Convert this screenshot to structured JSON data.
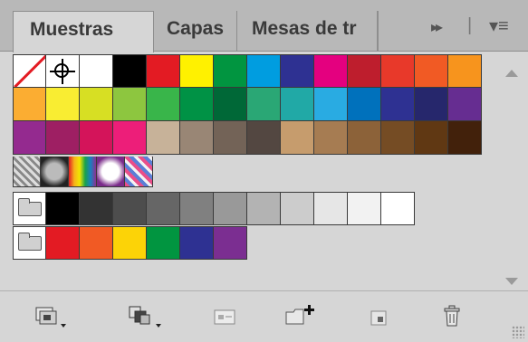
{
  "tabs": [
    {
      "label": "Muestras"
    },
    {
      "label": "Capas"
    },
    {
      "label": "Mesas de tr"
    }
  ],
  "tab_controls": {
    "expand": "▸▸",
    "separator": "|",
    "menu": "▾≡"
  },
  "swatches": {
    "row1": [
      "#ffffff",
      "#000000",
      "#e31b23",
      "#fff100",
      "#019540",
      "#009de0",
      "#2e3192",
      "#e4007f",
      "#be1e2d",
      "#e8392a",
      "#f15a24",
      "#f7941d"
    ],
    "row2": [
      "#fbad32",
      "#f9ed32",
      "#d7df23",
      "#8dc63f",
      "#39b54a",
      "#009245",
      "#006837",
      "#2aa775",
      "#21a9a6",
      "#29abe2",
      "#0071bc",
      "#2e3192",
      "#26276c",
      "#662d91"
    ],
    "row3": [
      "#942a8f",
      "#9e1f63",
      "#d4145a",
      "#ed1e79",
      "#c7b299",
      "#998675",
      "#736357",
      "#534741",
      "#c69c6d",
      "#a67c52",
      "#8c6239",
      "#754c24",
      "#603813",
      "#42210b"
    ],
    "row5": [
      "#000000",
      "#333333",
      "#4d4d4d",
      "#666666",
      "#808080",
      "#999999",
      "#b3b3b3",
      "#cccccc",
      "#e6e6e6",
      "#f2f2f2",
      "#ffffff"
    ],
    "row6": [
      "#e31b23",
      "#f15a24",
      "#fcd307",
      "#019540",
      "#2e3192",
      "#7b2e91"
    ]
  },
  "icons": {
    "none": "none-swatch-icon",
    "registration": "registration-target-icon",
    "folder": "folder-icon",
    "library": "swatch-library-icon",
    "kinds": "swatch-kinds-icon",
    "options": "swatch-options-icon",
    "new_group": "new-color-group-icon",
    "new_swatch": "new-swatch-icon",
    "trash": "trash-icon"
  }
}
